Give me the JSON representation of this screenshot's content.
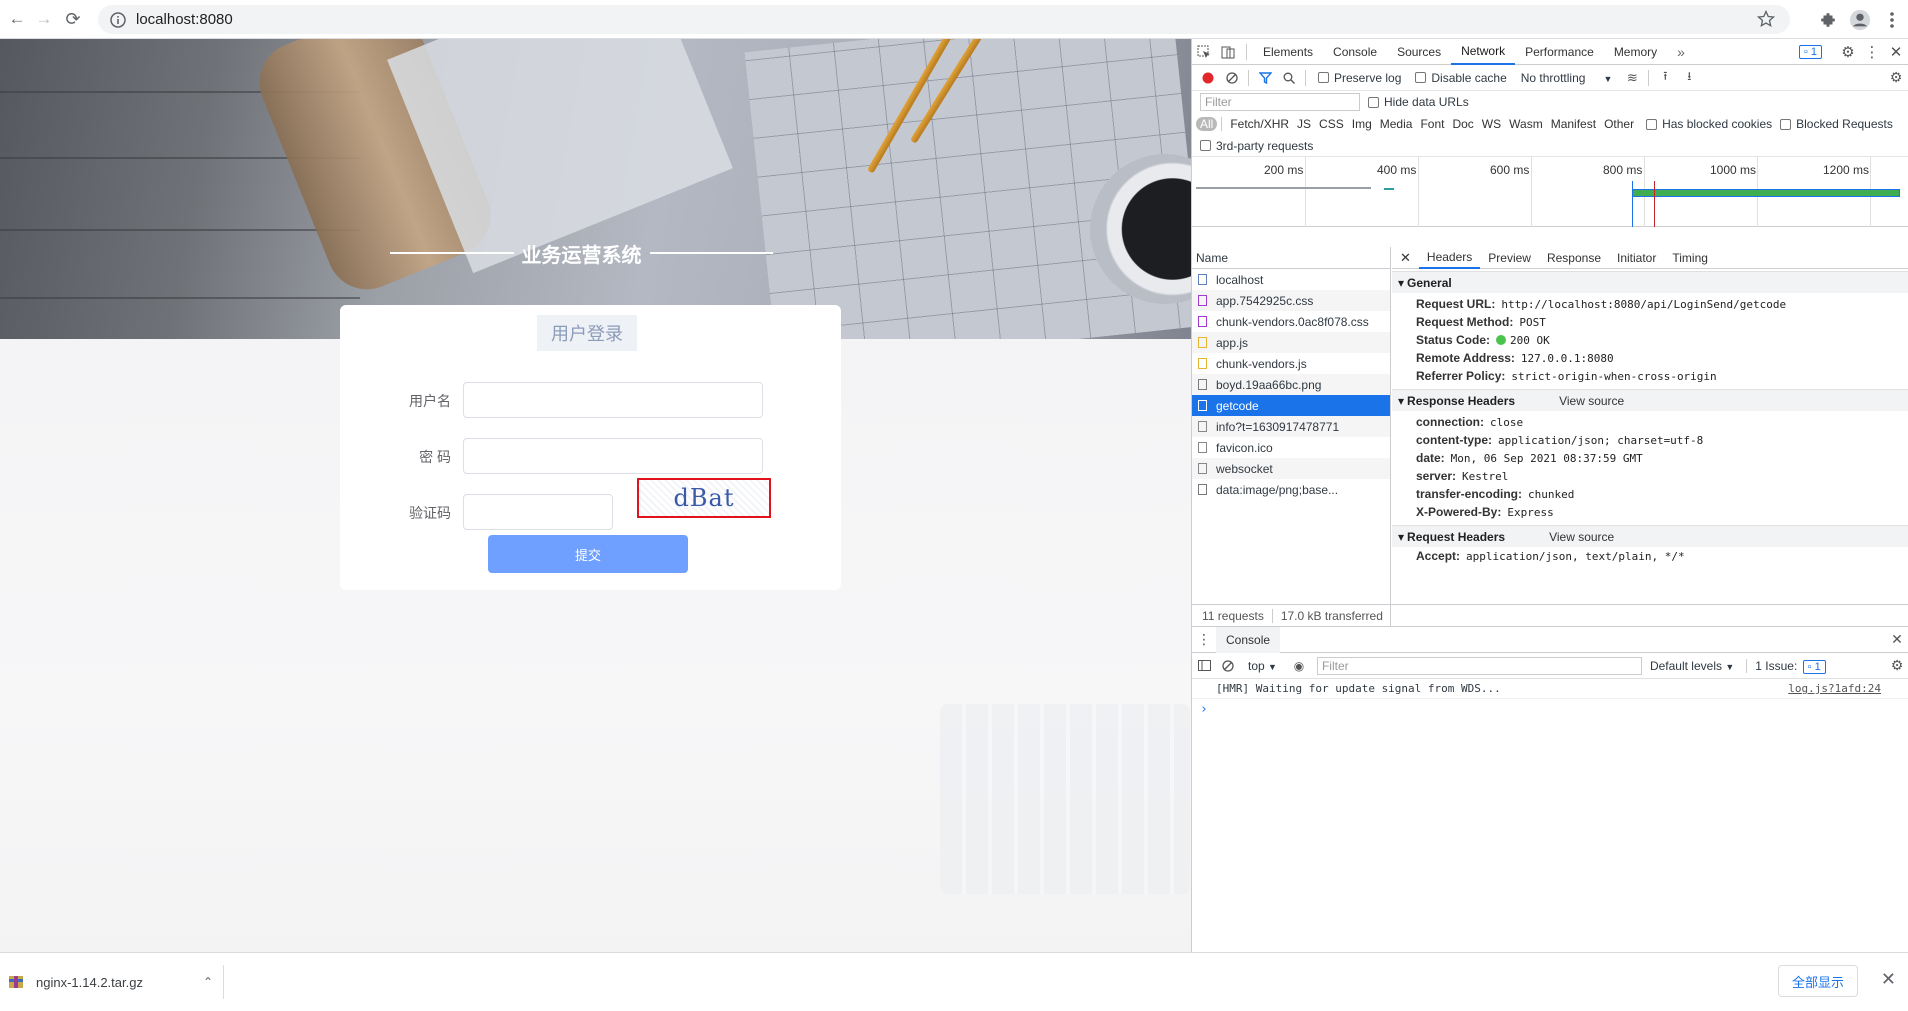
{
  "browser": {
    "url": "localhost:8080",
    "back_icon": "←",
    "forward_icon": "→",
    "reload_icon": "⟳"
  },
  "page": {
    "system_title": "业务运营系统",
    "login_title": "用户登录",
    "username_label": "用户名",
    "password_label": "密 码",
    "captcha_label": "验证码",
    "captcha_text": "dBat",
    "submit_label": "提交"
  },
  "devtools": {
    "tabs": [
      "Elements",
      "Console",
      "Sources",
      "Network",
      "Performance",
      "Memory"
    ],
    "active_tab": "Network",
    "more": "»",
    "issue_count": "1",
    "toolbar": {
      "preserve_log": "Preserve log",
      "disable_cache": "Disable cache",
      "throttling": "No throttling"
    },
    "filter_placeholder": "Filter",
    "hide_data_urls": "Hide data URLs",
    "types": [
      "All",
      "Fetch/XHR",
      "JS",
      "CSS",
      "Img",
      "Media",
      "Font",
      "Doc",
      "WS",
      "Wasm",
      "Manifest",
      "Other"
    ],
    "has_blocked_cookies": "Has blocked cookies",
    "blocked_requests": "Blocked Requests",
    "third_party": "3rd-party requests",
    "timeline_labels": [
      "200 ms",
      "400 ms",
      "600 ms",
      "800 ms",
      "1000 ms",
      "1200 ms"
    ],
    "name_header": "Name",
    "requests": [
      {
        "name": "localhost",
        "kind": "doc"
      },
      {
        "name": "app.7542925c.css",
        "kind": "css"
      },
      {
        "name": "chunk-vendors.0ac8f078.css",
        "kind": "css"
      },
      {
        "name": "app.js",
        "kind": "js"
      },
      {
        "name": "chunk-vendors.js",
        "kind": "js"
      },
      {
        "name": "boyd.19aa66bc.png",
        "kind": "img"
      },
      {
        "name": "getcode",
        "kind": "xhr",
        "selected": true
      },
      {
        "name": "info?t=1630917478771",
        "kind": "xhr"
      },
      {
        "name": "favicon.ico",
        "kind": "other"
      },
      {
        "name": "websocket",
        "kind": "other"
      },
      {
        "name": "data:image/png;base...",
        "kind": "img"
      }
    ],
    "footer": {
      "requests": "11 requests",
      "transferred": "17.0 kB transferred"
    },
    "detail_tabs": [
      "Headers",
      "Preview",
      "Response",
      "Initiator",
      "Timing"
    ],
    "active_detail_tab": "Headers",
    "general": {
      "title": "General",
      "rows": [
        {
          "k": "Request URL:",
          "v": "http://localhost:8080/api/LoginSend/getcode"
        },
        {
          "k": "Request Method:",
          "v": "POST"
        },
        {
          "k": "Status Code:",
          "v": "200 OK"
        },
        {
          "k": "Remote Address:",
          "v": "127.0.0.1:8080"
        },
        {
          "k": "Referrer Policy:",
          "v": "strict-origin-when-cross-origin"
        }
      ]
    },
    "response_headers": {
      "title": "Response Headers",
      "view_source": "View source",
      "rows": [
        {
          "k": "connection:",
          "v": "close"
        },
        {
          "k": "content-type:",
          "v": "application/json; charset=utf-8"
        },
        {
          "k": "date:",
          "v": "Mon, 06 Sep 2021 08:37:59 GMT"
        },
        {
          "k": "server:",
          "v": "Kestrel"
        },
        {
          "k": "transfer-encoding:",
          "v": "chunked"
        },
        {
          "k": "X-Powered-By:",
          "v": "Express"
        }
      ]
    },
    "request_headers": {
      "title": "Request Headers",
      "view_source": "View source",
      "rows": [
        {
          "k": "Accept:",
          "v": "application/json, text/plain, */*"
        }
      ]
    },
    "console": {
      "tab": "Console",
      "context": "top",
      "filter_placeholder": "Filter",
      "levels": "Default levels",
      "issues": "1 Issue:",
      "issue_count": "1",
      "message": "[HMR] Waiting for update signal from WDS...",
      "source": "log.js?1afd:24",
      "prompt": "›"
    }
  },
  "downloads": {
    "file": "nginx-1.14.2.tar.gz",
    "show_all": "全部显示"
  }
}
